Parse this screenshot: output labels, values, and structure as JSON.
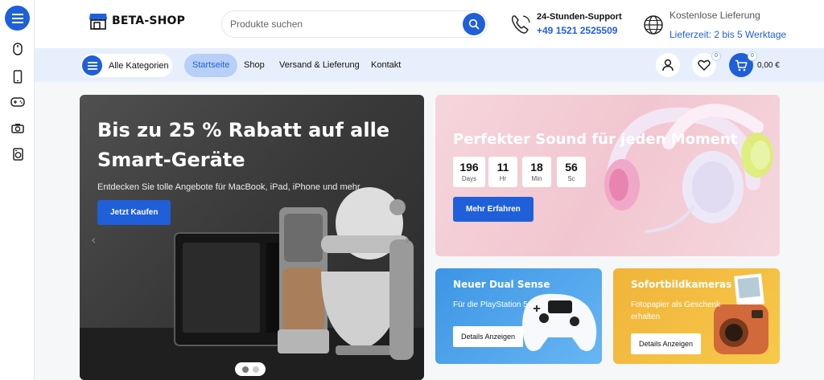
{
  "header": {
    "logo_text": "BETA-SHOP",
    "search_placeholder": "Produkte suchen",
    "support_title": "24-Stunden-Support",
    "support_phone": "+49 1521 2525509",
    "delivery_title": "Kostenlose Lieferung",
    "delivery_time": "Lieferzeit: 2 bis 5 Werktage"
  },
  "nav": {
    "categories_label": "Alle Kategorien",
    "items": [
      "Startseite",
      "Shop",
      "Versand & Lieferung",
      "Kontakt"
    ],
    "wishlist_count": "0",
    "cart_count": "0",
    "cart_total": "0,00 €"
  },
  "hero": {
    "title": "Bis zu 25 % Rabatt auf alle Smart-Geräte",
    "subtitle": "Entdecken Sie tolle Angebote für MacBook, iPad, iPhone und mehr.",
    "button": "Jetzt Kaufen"
  },
  "sound_banner": {
    "title": "Perfekter Sound für jeden Moment",
    "countdown": [
      {
        "value": "196",
        "unit": "Days"
      },
      {
        "value": "11",
        "unit": "Hr"
      },
      {
        "value": "18",
        "unit": "Min"
      },
      {
        "value": "56",
        "unit": "Sc"
      }
    ],
    "button": "Mehr Erfahren"
  },
  "dual_sense": {
    "title": "Neuer Dual Sense",
    "subtitle": "Für die PlayStation 5",
    "button": "Details Anzeigen"
  },
  "instant_camera": {
    "title": "Sofortbildkameras",
    "subtitle_line1": "Fotopapier als Geschenk",
    "subtitle_line2": "erhalten",
    "button": "Details Anzeigen"
  },
  "colors": {
    "primary": "#1f5fd9",
    "nav_bg": "#e8effc",
    "active_pill": "#b8d0f7"
  }
}
